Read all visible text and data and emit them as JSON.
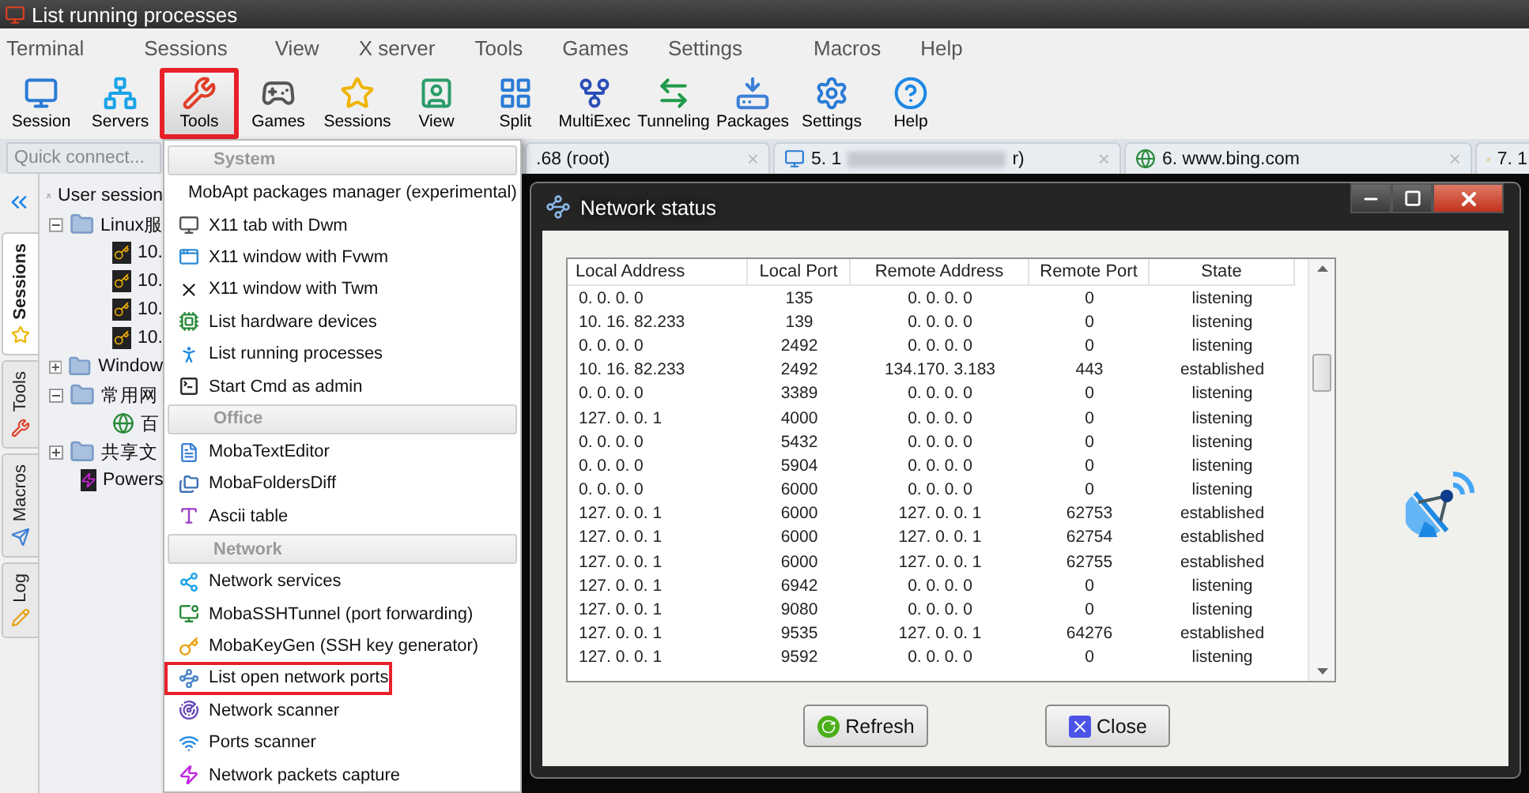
{
  "window": {
    "title": "List running processes"
  },
  "menubar": [
    "Terminal",
    "Sessions",
    "View",
    "X server",
    "Tools",
    "Games",
    "Settings",
    "Macros",
    "Help"
  ],
  "toolbar": [
    {
      "kind": "session",
      "label": "Session",
      "selected": false
    },
    {
      "kind": "servers",
      "label": "Servers",
      "selected": false
    },
    {
      "kind": "tools",
      "label": "Tools",
      "selected": true
    },
    {
      "kind": "games",
      "label": "Games",
      "selected": false
    },
    {
      "kind": "sessions",
      "label": "Sessions",
      "selected": false
    },
    {
      "kind": "view",
      "label": "View",
      "selected": false
    },
    {
      "kind": "split",
      "label": "Split",
      "selected": false
    },
    {
      "kind": "multiexec",
      "label": "MultiExec",
      "selected": false
    },
    {
      "kind": "tunneling",
      "label": "Tunneling",
      "selected": false
    },
    {
      "kind": "packages",
      "label": "Packages",
      "selected": false
    },
    {
      "kind": "settings",
      "label": "Settings",
      "selected": false
    },
    {
      "kind": "help",
      "label": "Help",
      "selected": false
    }
  ],
  "quick_connect": {
    "placeholder": "Quick connect..."
  },
  "tabs": [
    {
      "kind": "plain",
      "label": ".68 (root)",
      "redacted": false,
      "close": "×"
    },
    {
      "kind": "monitor",
      "label": "5. 1",
      "redacted": true,
      "tail": "r)",
      "close": "×"
    },
    {
      "kind": "globe",
      "label": "6. www.bing.com",
      "redacted": false,
      "close": "×"
    },
    {
      "kind": "key",
      "label": "7. 1",
      "redacted": false
    }
  ],
  "side_tabs": [
    {
      "kind": "sessions",
      "label": "Sessions",
      "selected": true
    },
    {
      "kind": "tools",
      "label": "Tools",
      "selected": false
    },
    {
      "kind": "macros",
      "label": "Macros",
      "selected": false
    },
    {
      "kind": "log",
      "label": "Log",
      "selected": false
    }
  ],
  "session_tree": [
    {
      "kind": "user",
      "label": "User session",
      "children": [
        {
          "kind": "folder",
          "label": "Linux服",
          "expanded": true,
          "children": [
            {
              "kind": "ssh",
              "label": "10."
            },
            {
              "kind": "ssh",
              "label": "10."
            },
            {
              "kind": "ssh",
              "label": "10."
            },
            {
              "kind": "ssh",
              "label": "10."
            }
          ]
        },
        {
          "kind": "folder",
          "label": "Window",
          "expanded": false
        },
        {
          "kind": "folder",
          "label": "常用网",
          "expanded": true,
          "children": [
            {
              "kind": "web",
              "label": "百"
            }
          ]
        },
        {
          "kind": "folder",
          "label": "共享文",
          "expanded": false
        },
        {
          "kind": "shell",
          "label": "Powers"
        }
      ]
    }
  ],
  "tools_menu": [
    {
      "kind": "header",
      "label": "System"
    },
    {
      "kind": "item",
      "label": "MobApt packages manager (experimental)",
      "highlighted": false
    },
    {
      "kind": "item",
      "label": "X11 tab with Dwm",
      "highlighted": false
    },
    {
      "kind": "item",
      "label": "X11 window with Fvwm",
      "highlighted": false
    },
    {
      "kind": "item",
      "label": "X11 window with Twm",
      "highlighted": false
    },
    {
      "kind": "item",
      "label": "List hardware devices",
      "highlighted": false
    },
    {
      "kind": "item",
      "label": "List running processes",
      "highlighted": false
    },
    {
      "kind": "item",
      "label": "Start Cmd as admin",
      "highlighted": false
    },
    {
      "kind": "header",
      "label": "Office"
    },
    {
      "kind": "item",
      "label": "MobaTextEditor",
      "highlighted": false
    },
    {
      "kind": "item",
      "label": "MobaFoldersDiff",
      "highlighted": false
    },
    {
      "kind": "item",
      "label": "Ascii table",
      "highlighted": false
    },
    {
      "kind": "header",
      "label": "Network"
    },
    {
      "kind": "item",
      "label": "Network services",
      "highlighted": false
    },
    {
      "kind": "item",
      "label": "MobaSSHTunnel (port forwarding)",
      "highlighted": false
    },
    {
      "kind": "item",
      "label": "MobaKeyGen (SSH key generator)",
      "highlighted": false
    },
    {
      "kind": "item",
      "label": "List open network ports",
      "highlighted": true
    },
    {
      "kind": "item",
      "label": "Network scanner",
      "highlighted": false
    },
    {
      "kind": "item",
      "label": "Ports scanner",
      "highlighted": false
    },
    {
      "kind": "item",
      "label": "Network packets capture",
      "highlighted": false
    }
  ],
  "dialog": {
    "title": "Network status",
    "columns": [
      "Local Address",
      "Local Port",
      "Remote Address",
      "Remote Port",
      "State"
    ],
    "rows": [
      [
        "0. 0. 0. 0",
        "135",
        "0. 0. 0. 0",
        "0",
        "listening"
      ],
      [
        "10. 16. 82.233",
        "139",
        "0. 0. 0. 0",
        "0",
        "listening"
      ],
      [
        "0. 0. 0. 0",
        "2492",
        "0. 0. 0. 0",
        "0",
        "listening"
      ],
      [
        "10. 16. 82.233",
        "2492",
        "134.170. 3.183",
        "443",
        "established"
      ],
      [
        "0. 0. 0. 0",
        "3389",
        "0. 0. 0. 0",
        "0",
        "listening"
      ],
      [
        "127. 0. 0. 1",
        "4000",
        "0. 0. 0. 0",
        "0",
        "listening"
      ],
      [
        "0. 0. 0. 0",
        "5432",
        "0. 0. 0. 0",
        "0",
        "listening"
      ],
      [
        "0. 0. 0. 0",
        "5904",
        "0. 0. 0. 0",
        "0",
        "listening"
      ],
      [
        "0. 0. 0. 0",
        "6000",
        "0. 0. 0. 0",
        "0",
        "listening"
      ],
      [
        "127. 0. 0. 1",
        "6000",
        "127. 0. 0. 1",
        "62753",
        "established"
      ],
      [
        "127. 0. 0. 1",
        "6000",
        "127. 0. 0. 1",
        "62754",
        "established"
      ],
      [
        "127. 0. 0. 1",
        "6000",
        "127. 0. 0. 1",
        "62755",
        "established"
      ],
      [
        "127. 0. 0. 1",
        "6942",
        "0. 0. 0. 0",
        "0",
        "listening"
      ],
      [
        "127. 0. 0. 1",
        "9080",
        "0. 0. 0. 0",
        "0",
        "listening"
      ],
      [
        "127. 0. 0. 1",
        "9535",
        "127. 0. 0. 1",
        "64276",
        "established"
      ],
      [
        "127. 0. 0. 1",
        "9592",
        "0. 0. 0. 0",
        "0",
        "listening"
      ]
    ],
    "buttons": [
      {
        "kind": "refresh",
        "label": "Refresh"
      },
      {
        "kind": "close",
        "label": "Close"
      }
    ]
  }
}
